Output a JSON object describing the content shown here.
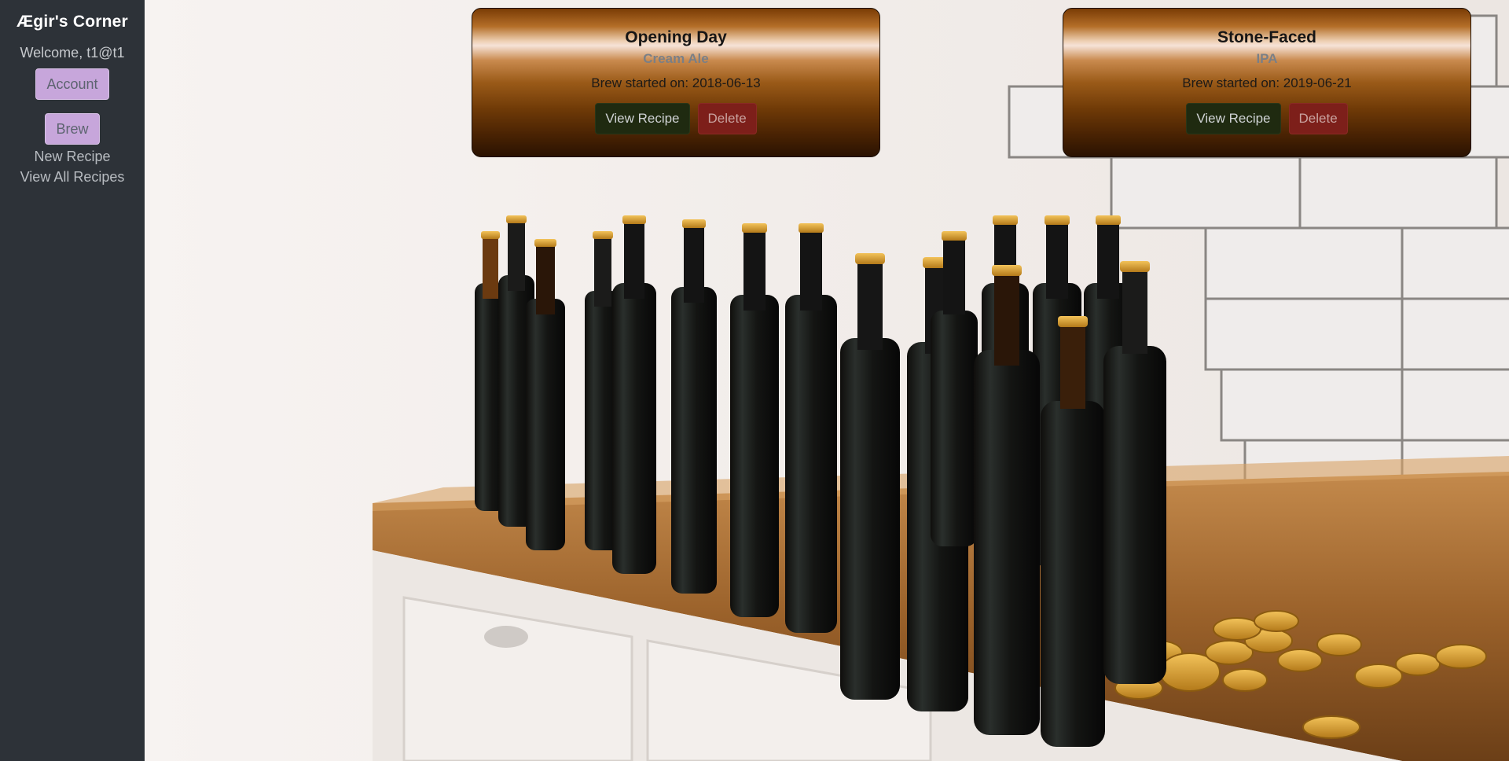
{
  "sidebar": {
    "brand": "Ægir's Corner",
    "welcome": "Welcome, t1@t1",
    "account_label": "Account",
    "brew_label": "Brew",
    "links": [
      "New Recipe",
      "View All Recipes"
    ]
  },
  "brews": [
    {
      "name": "Opening Day",
      "style": "Cream Ale",
      "started": "Brew started on: 2018-06-13",
      "view_label": "View Recipe",
      "delete_label": "Delete"
    },
    {
      "name": "Stone-Faced",
      "style": "IPA",
      "started": "Brew started on: 2019-06-21",
      "view_label": "View Recipe",
      "delete_label": "Delete"
    }
  ],
  "colors": {
    "sidebar_bg": "#2d3238",
    "sidebar_button": "#c7a6db",
    "view_button": "#1f2a10",
    "delete_button": "#7d1f1a"
  }
}
